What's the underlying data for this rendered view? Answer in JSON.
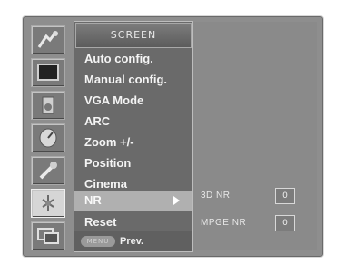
{
  "menu": {
    "title": "SCREEN",
    "items": [
      {
        "label": "Auto config."
      },
      {
        "label": "Manual config."
      },
      {
        "label": "VGA Mode"
      },
      {
        "label": "ARC"
      },
      {
        "label": "Zoom +/-"
      },
      {
        "label": "Position"
      },
      {
        "label": "Cinema"
      },
      {
        "label": "NR"
      },
      {
        "label": "Reset"
      }
    ],
    "selected_index": 7
  },
  "footer": {
    "menu_button": "MENU",
    "prev_label": "Prev."
  },
  "submenu": {
    "items": [
      {
        "label": "3D NR",
        "value": "0"
      },
      {
        "label": "MPGE NR",
        "value": "0"
      }
    ]
  },
  "icons": [
    "picture-icon",
    "sound-icon",
    "time-icon",
    "option-icon",
    "setup-icon",
    "screen-icon",
    "pip-icon"
  ],
  "colors": {
    "panel": "#8e8e8e",
    "menu_bg": "#6a6a6a",
    "highlight": "#b0b0b0"
  }
}
